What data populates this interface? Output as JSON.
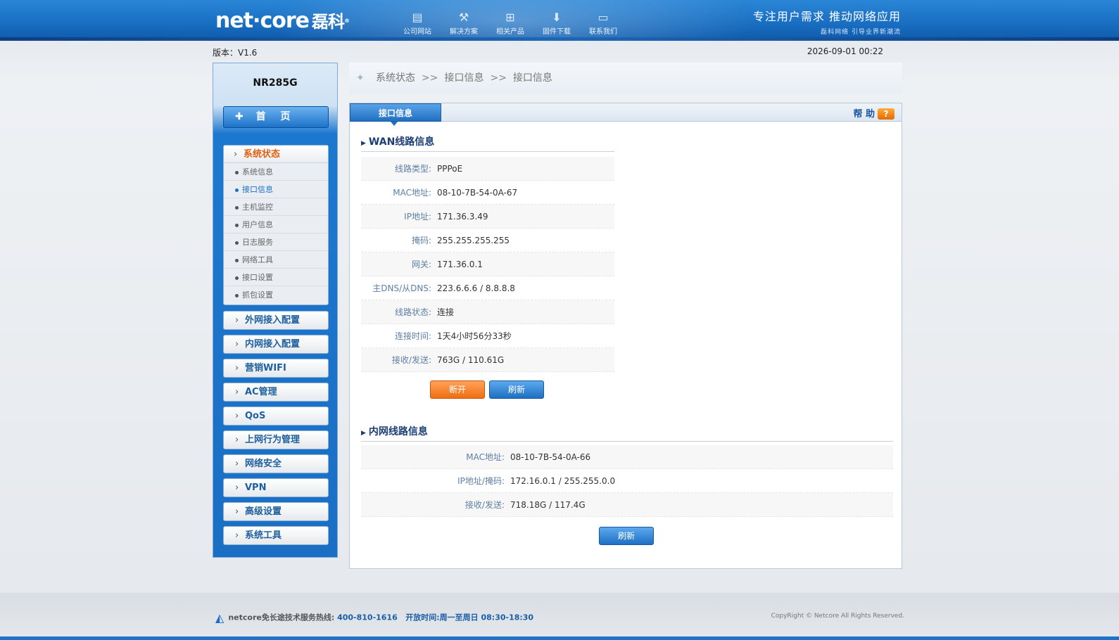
{
  "header": {
    "logo_main": "net·core",
    "logo_cn": "磊科",
    "logo_reg": "®",
    "nav": [
      {
        "label": "公司网站",
        "icon": "website-icon"
      },
      {
        "label": "解决方案",
        "icon": "tools-icon"
      },
      {
        "label": "相关产品",
        "icon": "router-icon"
      },
      {
        "label": "固件下载",
        "icon": "download-icon"
      },
      {
        "label": "联系我们",
        "icon": "chat-icon"
      }
    ],
    "slogan_big": "专注用户需求   推动网络应用",
    "slogan_small": "磊科网络 引导业界新潮流"
  },
  "version_label": "版本：V1.6",
  "datetime": "2026-09-01 00:22",
  "sidebar": {
    "model": "NR285G",
    "home": "首 页",
    "active_group": "系统状态",
    "sub_items": [
      "系统信息",
      "接口信息",
      "主机监控",
      "用户信息",
      "日志服务",
      "网络工具",
      "接口设置",
      "抓包设置"
    ],
    "menus": [
      "外网接入配置",
      "内网接入配置",
      "营销WIFI",
      "AC管理",
      "QoS",
      "上网行为管理",
      "网络安全",
      "VPN",
      "高级设置",
      "系统工具"
    ]
  },
  "breadcrumb": [
    "系统状态",
    "接口信息",
    "接口信息"
  ],
  "breadcrumb_sep": ">>",
  "tab": "接口信息",
  "help": "帮 助",
  "help_icon": "?",
  "wan": {
    "title": "WAN线路信息",
    "rows": [
      {
        "k": "线路类型:",
        "v": "PPPoE"
      },
      {
        "k": "MAC地址:",
        "v": "08-10-7B-54-0A-67"
      },
      {
        "k": "IP地址:",
        "v": "171.36.3.49"
      },
      {
        "k": "掩码:",
        "v": "255.255.255.255"
      },
      {
        "k": "网关:",
        "v": "171.36.0.1"
      },
      {
        "k": "主DNS/从DNS:",
        "v": "223.6.6.6 / 8.8.8.8"
      },
      {
        "k": "线路状态:",
        "v": "连接"
      },
      {
        "k": "连接时间:",
        "v": "1天4小时56分33秒"
      },
      {
        "k": "接收/发送:",
        "v": "763G / 110.61G"
      }
    ],
    "disconnect": "断开",
    "refresh": "刷新"
  },
  "lan": {
    "title": "内网线路信息",
    "rows": [
      {
        "k": "MAC地址:",
        "v": "08-10-7B-54-0A-66"
      },
      {
        "k": "IP地址/掩码:",
        "v": "172.16.0.1 / 255.255.0.0"
      },
      {
        "k": "接收/发送:",
        "v": "718.18G / 117.4G"
      }
    ],
    "refresh": "刷新"
  },
  "footer": {
    "hotline_prefix": "netcore免长途技术服务热线:",
    "hotline_number": "400-810-1616",
    "hours_prefix": "开放时间:",
    "hours": "周一至周日 08:30-18:30",
    "copyright": "CopyRight © Netcore All Rights Reserved."
  }
}
